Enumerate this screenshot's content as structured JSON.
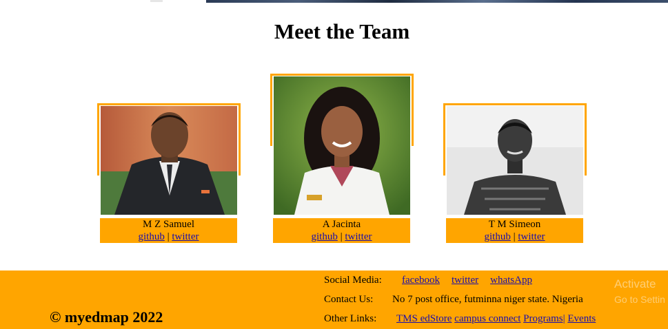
{
  "section_title": "Meet the Team",
  "team": [
    {
      "name": "M Z Samuel",
      "github": "github",
      "separator": "|",
      "twitter": "twitter"
    },
    {
      "name": "A Jacinta",
      "github": "github",
      "separator": "|",
      "twitter": "twitter"
    },
    {
      "name": "T M Simeon",
      "github": "github",
      "separator": "|",
      "twitter": "twitter"
    }
  ],
  "footer": {
    "copyright": "© myedmap 2022",
    "social_label": "Social Media:",
    "social_links": [
      "facebook",
      "twitter",
      "whatsApp"
    ],
    "contact_label": "Contact Us:",
    "contact_value": "No 7 post office, futminna niger state. Nigeria",
    "other_label": "Other Links:",
    "other_links": [
      "TMS edStore",
      "campus connect",
      "Programs|",
      "Events"
    ]
  },
  "watermark": {
    "line1": "Activate",
    "line2": "Go to Settin"
  },
  "colors": {
    "accent": "#ffa500",
    "link": "#1a0dab"
  }
}
